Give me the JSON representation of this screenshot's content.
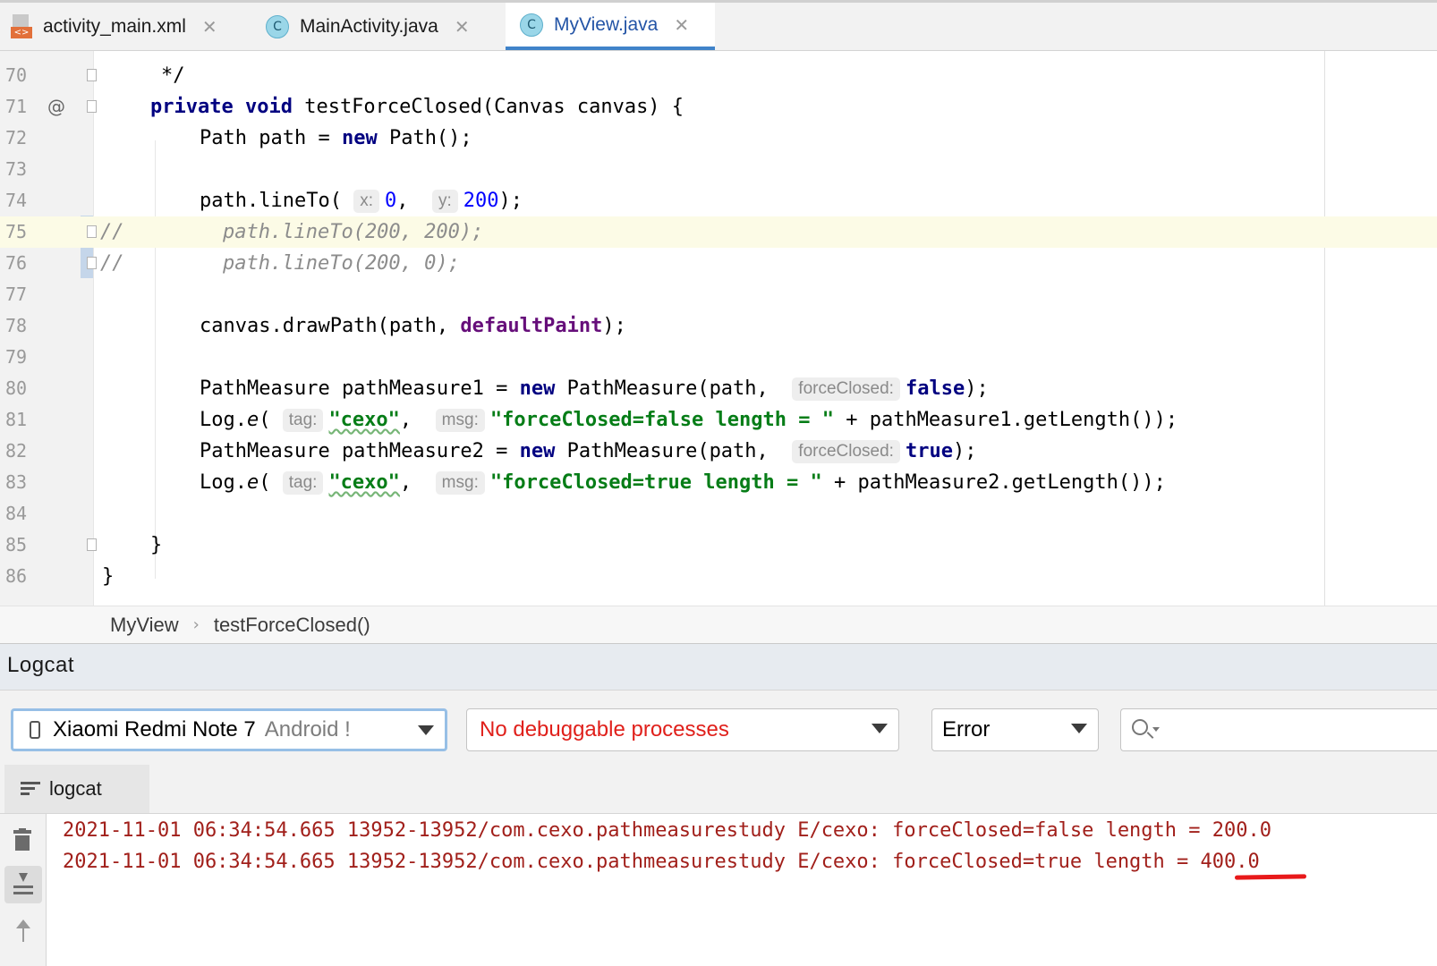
{
  "tabs": [
    {
      "label": "activity_main.xml",
      "icon": "xml-file-icon",
      "active": false
    },
    {
      "label": "MainActivity.java",
      "icon": "java-class-icon",
      "active": false
    },
    {
      "label": "MyView.java",
      "icon": "java-class-icon",
      "active": true
    }
  ],
  "editor": {
    "line_numbers": [
      "70",
      "71",
      "72",
      "73",
      "74",
      "75",
      "76",
      "77",
      "78",
      "79",
      "80",
      "81",
      "82",
      "83",
      "84",
      "85",
      "86"
    ],
    "override_marker": "@",
    "comment_prefix": "//",
    "code": {
      "l70": "*/",
      "l71_kw1": "private",
      "l71_kw2": "void",
      "l71_rest": "testForceClosed(Canvas canvas) {",
      "l72_a": "Path path = ",
      "l72_kw": "new",
      "l72_b": "Path();",
      "l74_a": "path.lineTo(",
      "l74_hint_x": "x:",
      "l74_x": "0",
      "l74_sep": ",",
      "l74_hint_y": "y:",
      "l74_y": "200",
      "l74_end": ");",
      "l75": "path.lineTo(200, 200);",
      "l76": "path.lineTo(200, 0);",
      "l78_a": "canvas.drawPath(path, ",
      "l78_field": "defaultPaint",
      "l78_end": ");",
      "l80_a": "PathMeasure pathMeasure1 = ",
      "l80_kw": "new",
      "l80_b": "PathMeasure(path,",
      "l80_hint": "forceClosed:",
      "l80_val": "false",
      "l80_end": ");",
      "l81_a": "Log.",
      "l81_e": "e",
      "l81_paren": "(",
      "l81_hint_tag": "tag:",
      "l81_tag": "\"cexo\"",
      "l81_sep": ",",
      "l81_hint_msg": "msg:",
      "l81_msg": "\"forceClosed=false length = \"",
      "l81_end": "+ pathMeasure1.getLength());",
      "l82_a": "PathMeasure pathMeasure2 = ",
      "l82_kw": "new",
      "l82_b": "PathMeasure(path,",
      "l82_hint": "forceClosed:",
      "l82_val": "true",
      "l82_end": ");",
      "l83_a": "Log.",
      "l83_e": "e",
      "l83_paren": "(",
      "l83_hint_tag": "tag:",
      "l83_tag": "\"cexo\"",
      "l83_sep": ",",
      "l83_hint_msg": "msg:",
      "l83_msg": "\"forceClosed=true length = \"",
      "l83_end": "+ pathMeasure2.getLength());",
      "l85": "}",
      "l86": "}"
    }
  },
  "breadcrumb": {
    "class_name": "MyView",
    "separator": "›",
    "method": "testForceClosed()"
  },
  "logcat": {
    "title": "Logcat",
    "device": {
      "name": "Xiaomi Redmi Note 7",
      "os": "Android !"
    },
    "process": "No debuggable processes",
    "level": "Error",
    "search_placeholder": "",
    "subtab": "logcat",
    "lines": [
      "2021-11-01 06:34:54.665 13952-13952/com.cexo.pathmeasurestudy E/cexo: forceClosed=false length = 200.0",
      "2021-11-01 06:34:54.665 13952-13952/com.cexo.pathmeasurestudy E/cexo: forceClosed=true length = 400.0"
    ]
  },
  "colors": {
    "keyword": "#000080",
    "string": "#067d17",
    "number": "#0000ff",
    "field": "#660e7a",
    "comment": "#8c8c8c",
    "log_error": "#a11f1a",
    "active_tab": "#2354a6",
    "annotation_underline": "#e8191a"
  }
}
